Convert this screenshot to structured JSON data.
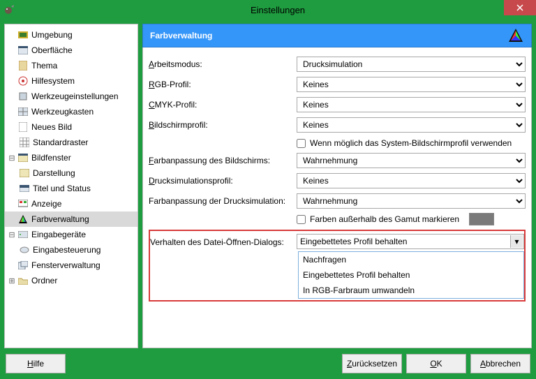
{
  "window": {
    "title": "Einstellungen"
  },
  "sidebar": {
    "items": [
      {
        "label": "Umgebung"
      },
      {
        "label": "Oberfläche"
      },
      {
        "label": "Thema"
      },
      {
        "label": "Hilfesystem"
      },
      {
        "label": "Werkzeugeinstellungen"
      },
      {
        "label": "Werkzeugkasten"
      },
      {
        "label": "Neues Bild"
      },
      {
        "label": "Standardraster"
      },
      {
        "label": "Bildfenster"
      },
      {
        "label": "Darstellung"
      },
      {
        "label": "Titel und Status"
      },
      {
        "label": "Anzeige"
      },
      {
        "label": "Farbverwaltung"
      },
      {
        "label": "Eingabegeräte"
      },
      {
        "label": "Eingabesteuerung"
      },
      {
        "label": "Fensterverwaltung"
      },
      {
        "label": "Ordner"
      }
    ]
  },
  "section": {
    "title": "Farbverwaltung"
  },
  "form": {
    "mode_label": "Arbeitsmodus:",
    "mode_value": "Drucksimulation",
    "rgb_label": "RGB-Profil:",
    "rgb_value": "Keines",
    "cmyk_label": "CMYK-Profil:",
    "cmyk_value": "Keines",
    "screen_label": "Bildschirmprofil:",
    "screen_value": "Keines",
    "screen_chk": "Wenn möglich das System-Bildschirmprofil verwenden",
    "screenadj_label": "Farbanpassung des Bildschirms:",
    "screenadj_value": "Wahrnehmung",
    "printsim_label": "Drucksimulationsprofil:",
    "printsim_value": "Keines",
    "printadj_label": "Farbanpassung der Drucksimulation:",
    "printadj_value": "Wahrnehmung",
    "gamut_chk": "Farben außerhalb des Gamut markieren",
    "openfile_label": "Verhalten des Datei-Öffnen-Dialogs:",
    "openfile_value": "Eingebettetes Profil behalten",
    "openfile_options": [
      "Nachfragen",
      "Eingebettetes Profil behalten",
      "In RGB-Farbraum umwandeln"
    ]
  },
  "buttons": {
    "help": "Hilfe",
    "reset": "Zurücksetzen",
    "ok": "OK",
    "cancel": "Abbrechen"
  },
  "chart_data": null
}
